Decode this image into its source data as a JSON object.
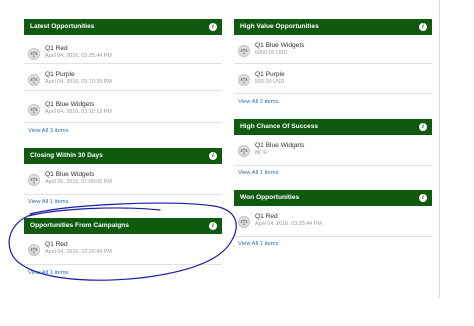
{
  "left_column": {
    "latest_opportunities": {
      "title": "Latest Opportunities",
      "items": [
        {
          "name": "Q1 Red",
          "date": "April 04, 2016, 03:25:44 PM"
        },
        {
          "name": "Q1 Purple",
          "date": "April 04, 2016, 03:10:35 PM"
        },
        {
          "name": "Q1 Blue Widgets",
          "date": "April 04, 2016, 03:10:13 PM"
        }
      ],
      "view_all": "View All 3 items"
    },
    "closing_within_30_days": {
      "title": "Closing Within 30 Days",
      "items": [
        {
          "name": "Q1 Blue Widgets",
          "date": "April 26, 2016, 07:00:00 PM"
        }
      ],
      "view_all": "View All 1 items"
    },
    "opportunities_from_campaigns": {
      "title": "Opportunities From Campaigns",
      "items": [
        {
          "name": "Q1 Red",
          "date": "April 04, 2016, 03:25:44 PM"
        }
      ],
      "view_all": "View All 1 items"
    }
  },
  "right_column": {
    "high_value_opportunities": {
      "title": "High Value Opportunities",
      "items": [
        {
          "name": "Q1 Blue Widgets",
          "value": "6000.00 USD"
        },
        {
          "name": "Q1 Purple",
          "value": "500.00 USD"
        }
      ],
      "view_all": "View All 2 items"
    },
    "high_chance_of_success": {
      "title": "High Chance Of Success",
      "items": [
        {
          "name": "Q1 Blue Widgets",
          "value": "86 %"
        }
      ],
      "view_all": "View All 1 items"
    },
    "won_opportunities": {
      "title": "Won Opportunities",
      "items": [
        {
          "name": "Q1 Red",
          "date": "April 04, 2016, 03:25:44 PM"
        }
      ],
      "view_all": "View All 1 items"
    }
  },
  "info_glyph": "i",
  "colors": {
    "header_bg": "#0f5a0f",
    "link": "#2a6fb5",
    "annotation_stroke": "#1c1caa"
  }
}
